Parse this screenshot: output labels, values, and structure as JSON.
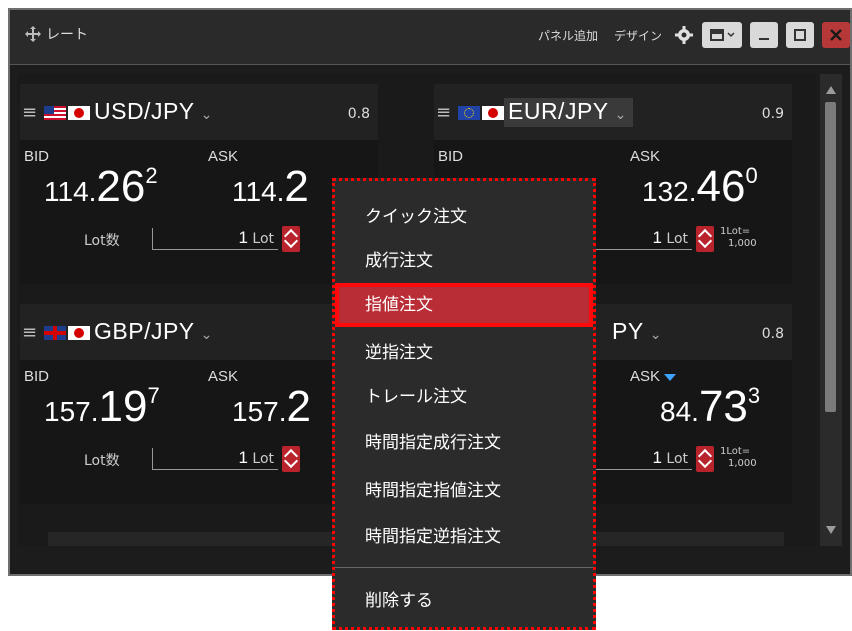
{
  "window": {
    "title": "レート",
    "add_panel": "パネル追加",
    "design": "デザイン"
  },
  "panels": [
    {
      "pair": "USD/JPY",
      "spread": "0.8",
      "bid_label": "BID",
      "ask_label": "ASK",
      "bid_small": "114.",
      "bid_big": "26",
      "bid_sup": "2",
      "ask_small": "114.",
      "ask_big": "2",
      "ask_sup": "",
      "lot_label": "Lot数",
      "lot_value": "1",
      "lot_unit": "Lot"
    },
    {
      "pair": "EUR/JPY",
      "spread": "0.9",
      "bid_label": "BID",
      "ask_label": "ASK",
      "ask_small": "132.",
      "ask_big": "46",
      "ask_sup": "0",
      "lot_value": "1",
      "lot_unit": "Lot",
      "lot_note_1": "1Lot=",
      "lot_note_2": "1,000"
    },
    {
      "pair": "GBP/JPY",
      "bid_label": "BID",
      "ask_label": "ASK",
      "bid_small": "157.",
      "bid_big": "19",
      "bid_sup": "7",
      "ask_small": "157.",
      "ask_big": "2",
      "lot_label": "Lot数",
      "lot_value": "1",
      "lot_unit": "Lot"
    },
    {
      "pair_partial": "PY",
      "spread": "0.8",
      "ask_label": "ASK",
      "ask_small": "84.",
      "ask_big": "73",
      "ask_sup": "3",
      "lot_value": "1",
      "lot_unit": "Lot",
      "lot_note_1": "1Lot=",
      "lot_note_2": "1,000"
    }
  ],
  "context_menu": {
    "items": [
      "クイック注文",
      "成行注文",
      "指値注文",
      "逆指注文",
      "トレール注文",
      "時間指定成行注文",
      "時間指定指値注文",
      "時間指定逆指注文"
    ],
    "delete": "削除する",
    "active_index": 2
  },
  "colors": {
    "accent_red": "#b82d36",
    "highlight_border": "#ff0a0a",
    "close_button": "#b73838"
  }
}
